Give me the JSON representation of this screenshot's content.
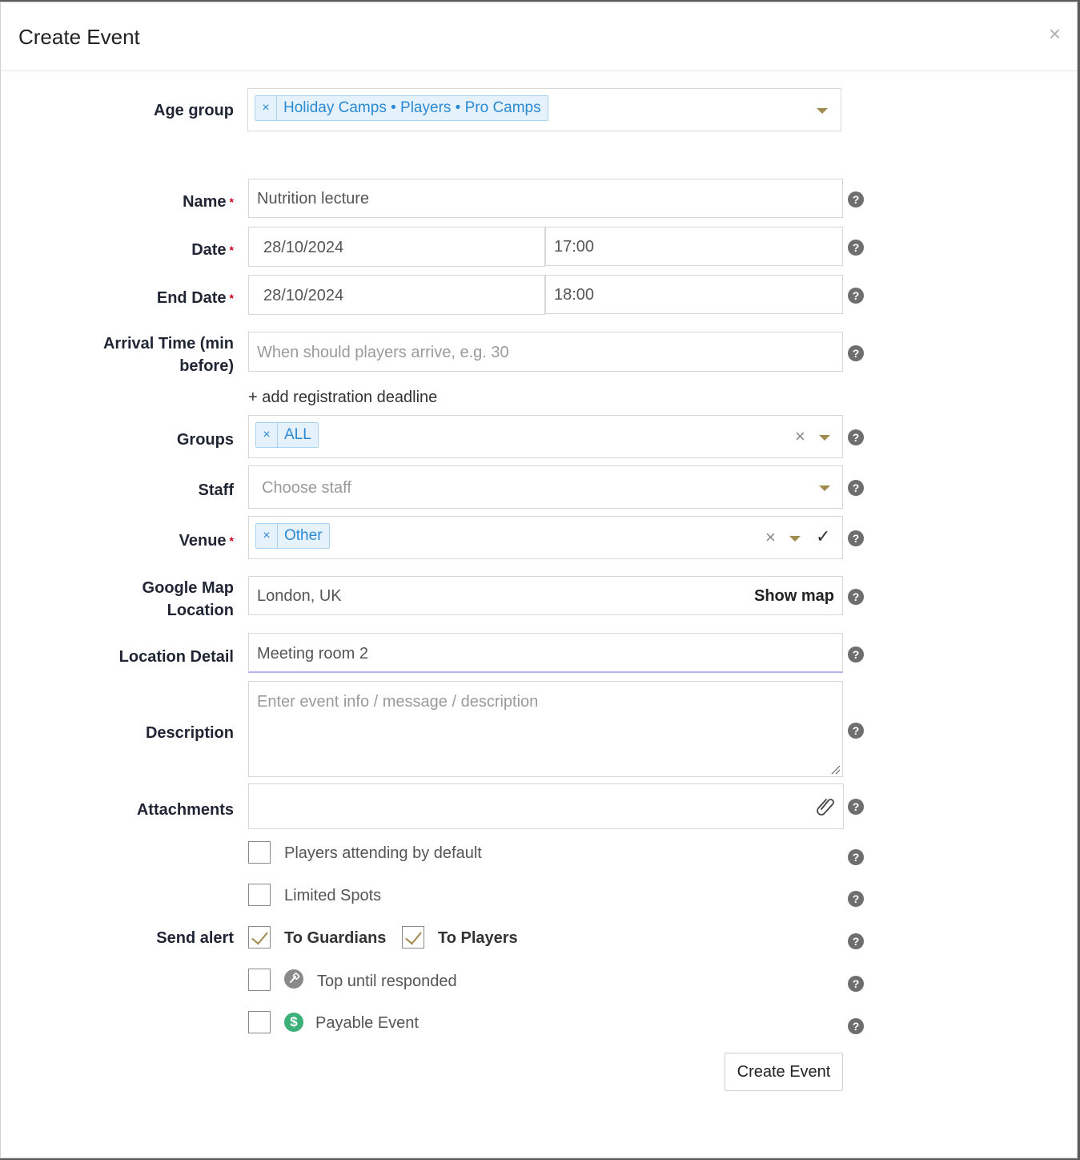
{
  "dialog": {
    "title": "Create Event",
    "close_label": "×"
  },
  "age_group": {
    "label": "Age group",
    "tag_remove": "×",
    "tag": "Holiday Camps • Players • Pro Camps"
  },
  "name": {
    "label": "Name",
    "required": "*",
    "value": "Nutrition lecture",
    "help": "?"
  },
  "date": {
    "label": "Date",
    "required": "*",
    "date_value": "28/10/2024",
    "time_value": "17:00",
    "help": "?"
  },
  "end_date": {
    "label": "End Date",
    "required": "*",
    "date_value": "28/10/2024",
    "time_value": "18:00",
    "help": "?"
  },
  "arrival": {
    "label_line1": "Arrival Time (min",
    "label_line2": "before)",
    "placeholder": "When should players arrive, e.g. 30",
    "help": "?"
  },
  "registration": {
    "link": "+ add registration deadline"
  },
  "groups": {
    "label": "Groups",
    "tag_remove": "×",
    "tag": "ALL",
    "clear": "×",
    "help": "?"
  },
  "staff": {
    "label": "Staff",
    "placeholder": "Choose staff",
    "help": "?"
  },
  "venue": {
    "label": "Venue",
    "required": "*",
    "tag_remove": "×",
    "tag": "Other",
    "clear": "×",
    "confirm": "✓",
    "help": "?"
  },
  "map": {
    "label_line1": "Google Map",
    "label_line2": "Location",
    "value": "London, UK",
    "show_map": "Show map",
    "help": "?"
  },
  "location_detail": {
    "label": "Location Detail",
    "value": "Meeting room 2",
    "help": "?"
  },
  "description": {
    "label": "Description",
    "placeholder": "Enter event info / message / description",
    "help": "?"
  },
  "attachments": {
    "label": "Attachments",
    "icon": "paperclip-icon",
    "help": "?"
  },
  "options": {
    "attending_default": {
      "label": "Players attending by default",
      "checked": false,
      "help": "?"
    },
    "limited_spots": {
      "label": "Limited Spots",
      "checked": false,
      "help": "?"
    },
    "send_alert": {
      "label": "Send alert",
      "to_guardians": "To Guardians",
      "to_guardians_checked": true,
      "to_players": "To Players",
      "to_players_checked": true,
      "help": "?"
    },
    "top_until": {
      "label": "Top until responded",
      "icon": "pin-icon",
      "checked": false,
      "help": "?"
    },
    "payable": {
      "label": "Payable Event",
      "icon": "dollar-icon",
      "checked": false,
      "help": "?"
    }
  },
  "submit": {
    "label": "Create Event"
  },
  "colors": {
    "accent_caret": "#a08a4f",
    "tag_text": "#2a8ad4",
    "tag_bg": "#e6f2fb",
    "focus_underline": "#b3b3f0",
    "dollar_green": "#3db07a"
  }
}
